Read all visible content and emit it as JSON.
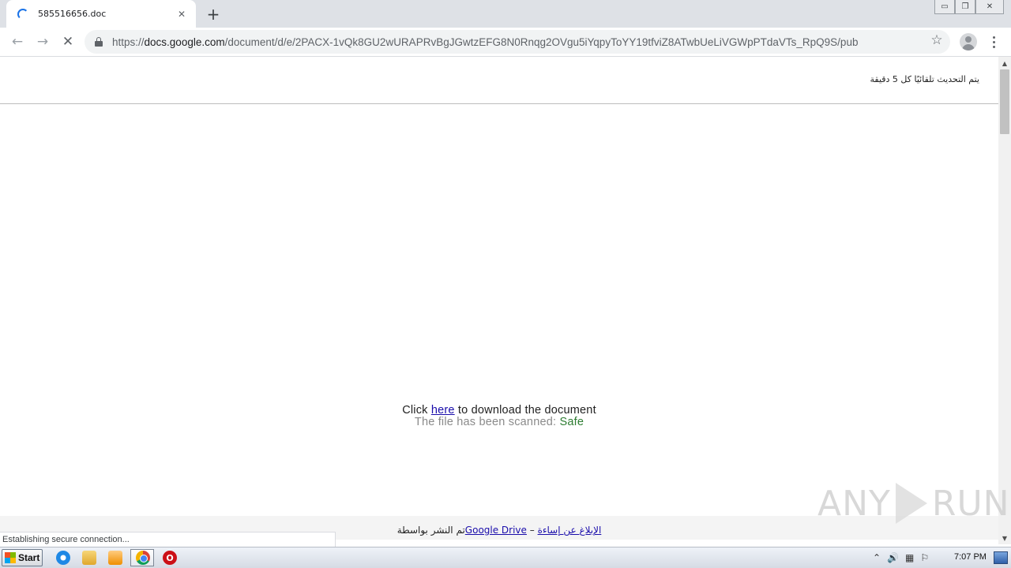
{
  "browser": {
    "tab_title": "585516656.doc",
    "tab_close": "✕",
    "new_tab": "+",
    "url_scheme": "https://",
    "url_host": "docs.google.com",
    "url_path": "/document/d/e/2PACX-1vQk8GU2wURAPRvBgJGwtzEFG8N0Rnqg2OVgu5iYqpyToYY19tfviZ8ATwbUeLiVGWpPTdaVTs_RpQ9S/pub",
    "back_icon": "←",
    "forward_icon": "→",
    "stop_icon": "✕",
    "star_icon": "☆",
    "window_controls": [
      "▭",
      "❐",
      "✕"
    ]
  },
  "page": {
    "update_notice": "يتم التحديث تلقائيًا كل 5 دقيقة",
    "click_prefix": "Click ",
    "here_link": "here",
    "click_suffix": " to download the document",
    "scanned_text": "The file has been scanned: ",
    "safe_text": "Safe",
    "footer_published_by": "تم النشر بواسطة ",
    "footer_drive_link": "Google Drive",
    "footer_dash": " – ",
    "footer_report_link": "الإبلاغ عن إساءة"
  },
  "status_bar": {
    "text": "Establishing secure connection..."
  },
  "watermark": {
    "left": "ANY",
    "right": "RUN"
  },
  "taskbar": {
    "start_label": "Start",
    "opera_glyph": "O",
    "clock": "7:07 PM",
    "tray_icons": [
      "⌃",
      "🔊",
      "▦",
      "⚐"
    ]
  }
}
